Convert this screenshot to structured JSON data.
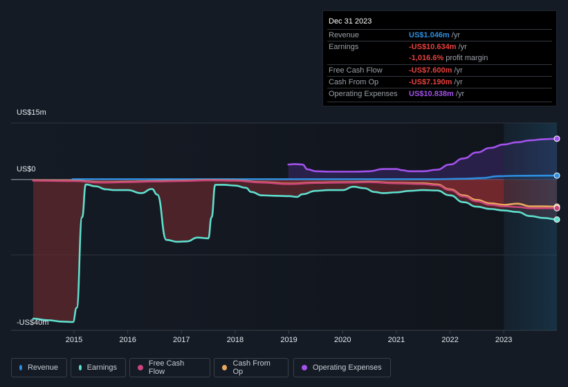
{
  "tooltip": {
    "date": "Dec 31 2023",
    "rows": [
      {
        "label": "Revenue",
        "value": "US$1.046m",
        "unit": " /yr",
        "color": "#2e8fe0"
      },
      {
        "label": "Earnings",
        "value": "-US$10.634m",
        "unit": " /yr",
        "color": "#e8413e"
      },
      {
        "label": "",
        "value": "-1,016.6%",
        "unit": " profit margin",
        "color": "#e8413e"
      },
      {
        "label": "Free Cash Flow",
        "value": "-US$7.600m",
        "unit": " /yr",
        "color": "#e8413e"
      },
      {
        "label": "Cash From Op",
        "value": "-US$7.190m",
        "unit": " /yr",
        "color": "#e8413e"
      },
      {
        "label": "Operating Expenses",
        "value": "US$10.838m",
        "unit": " /yr",
        "color": "#a452ee"
      }
    ]
  },
  "legend": [
    {
      "label": "Revenue",
      "color": "#2e8fe0"
    },
    {
      "label": "Earnings",
      "color": "#5fe0cf"
    },
    {
      "label": "Free Cash Flow",
      "color": "#c8457a"
    },
    {
      "label": "Cash From Op",
      "color": "#e8a95c"
    },
    {
      "label": "Operating Expenses",
      "color": "#a452ee"
    }
  ],
  "chart_data": {
    "type": "line",
    "title": "",
    "xlabel": "",
    "ylabel": "",
    "x_ticks": [
      "2015",
      "2016",
      "2017",
      "2018",
      "2019",
      "2020",
      "2021",
      "2022",
      "2023"
    ],
    "y_ticks": [
      {
        "value": 15,
        "label": "US$15m"
      },
      {
        "value": 0,
        "label": "US$0"
      },
      {
        "value": -20,
        "label": ""
      },
      {
        "value": -40,
        "label": "-US$40m"
      }
    ],
    "xlim": [
      2014.24,
      2023.99
    ],
    "ylim": [
      -40,
      15
    ],
    "units": "US$ millions",
    "highlight_start": 2023.0,
    "grid": true,
    "series": [
      {
        "name": "Revenue",
        "color": "#2e8fe0",
        "x": [
          2014.97,
          2016,
          2017,
          2018,
          2019,
          2020,
          2021,
          2021.75,
          2022.25,
          2022.6,
          2022.9,
          2023.25,
          2023.99
        ],
        "y": [
          0.1,
          0.1,
          0.1,
          0.1,
          0.1,
          0.1,
          0.1,
          0.1,
          0.2,
          0.4,
          0.9,
          1.0,
          1.05
        ]
      },
      {
        "name": "Earnings",
        "color": "#5fe0cf",
        "x": [
          2014.24,
          2014.5,
          2014.8,
          2014.98,
          2015.05,
          2015.15,
          2015.22,
          2015.4,
          2015.6,
          2015.75,
          2016,
          2016.25,
          2016.45,
          2016.55,
          2016.72,
          2016.92,
          2017.1,
          2017.3,
          2017.5,
          2017.56,
          2017.63,
          2017.78,
          2018,
          2018.2,
          2018.3,
          2018.5,
          2018.75,
          2019,
          2019.15,
          2019.25,
          2019.5,
          2019.75,
          2020,
          2020.2,
          2020.4,
          2020.6,
          2020.75,
          2021,
          2021.25,
          2021.5,
          2021.75,
          2022,
          2022.25,
          2022.5,
          2022.75,
          2023,
          2023.25,
          2023.5,
          2023.75,
          2023.99
        ],
        "y": [
          -36.9,
          -37.3,
          -37.7,
          -37.8,
          -34,
          -10,
          -1.3,
          -1.8,
          -2.6,
          -2.8,
          -2.8,
          -3.6,
          -2.5,
          -4,
          -16,
          -16.5,
          -16.4,
          -15.4,
          -15.6,
          -10,
          -1.4,
          -1.4,
          -1.6,
          -2.2,
          -3.3,
          -4.2,
          -4.3,
          -4.4,
          -4.6,
          -3.9,
          -3.0,
          -2.8,
          -2.8,
          -1.9,
          -2.3,
          -3.3,
          -3.6,
          -3.4,
          -3.0,
          -2.8,
          -2.9,
          -4.2,
          -6.0,
          -7.2,
          -7.8,
          -8.2,
          -8.6,
          -9.7,
          -10.2,
          -10.6
        ]
      },
      {
        "name": "Free Cash Flow",
        "color": "#c8457a",
        "x": [
          2014.24,
          2015,
          2015.5,
          2016,
          2016.5,
          2017,
          2017.5,
          2018,
          2018.5,
          2019,
          2019.5,
          2020,
          2020.5,
          2021,
          2021.5,
          2021.75,
          2022,
          2022.25,
          2022.5,
          2022.75,
          2023,
          2023.25,
          2023.5,
          2023.75,
          2023.99
        ],
        "y": [
          -0.3,
          -0.4,
          -0.8,
          -0.7,
          -0.5,
          -0.4,
          -0.2,
          -0.3,
          -0.8,
          -1.2,
          -0.9,
          -0.8,
          -0.7,
          -1.0,
          -1.2,
          -1.5,
          -2.8,
          -4.5,
          -5.8,
          -6.7,
          -7.1,
          -7.3,
          -7.6,
          -7.6,
          -7.6
        ]
      },
      {
        "name": "Cash From Op",
        "color": "#e8a95c",
        "x": [
          2014.24,
          2015,
          2015.5,
          2016,
          2016.5,
          2017,
          2017.5,
          2018,
          2018.5,
          2019,
          2019.5,
          2020,
          2020.5,
          2021,
          2021.5,
          2021.75,
          2022,
          2022.25,
          2022.5,
          2022.75,
          2023,
          2023.25,
          2023.5,
          2023.75,
          2023.99
        ],
        "y": [
          -0.2,
          -0.3,
          -0.7,
          -0.6,
          -0.4,
          -0.3,
          -0.1,
          -0.2,
          -0.7,
          -1.1,
          -0.8,
          -0.7,
          -0.6,
          -0.9,
          -1.0,
          -1.3,
          -2.6,
          -4.2,
          -5.4,
          -6.3,
          -6.7,
          -6.4,
          -7.1,
          -7.1,
          -7.19
        ]
      },
      {
        "name": "Operating Expenses",
        "color": "#a452ee",
        "x": [
          2018.99,
          2019.1,
          2019.25,
          2019.35,
          2019.5,
          2019.75,
          2020,
          2020.25,
          2020.5,
          2020.75,
          2021,
          2021.1,
          2021.25,
          2021.5,
          2021.75,
          2022,
          2022.25,
          2022.5,
          2022.75,
          2023,
          2023.25,
          2023.5,
          2023.75,
          2023.99
        ],
        "y": [
          4.0,
          4.1,
          4.0,
          2.7,
          2.2,
          2.1,
          2.1,
          2.1,
          2.2,
          2.8,
          2.8,
          2.5,
          2.2,
          2.2,
          2.6,
          4.0,
          5.6,
          7.2,
          8.4,
          9.3,
          9.9,
          10.4,
          10.7,
          10.84
        ]
      }
    ]
  }
}
